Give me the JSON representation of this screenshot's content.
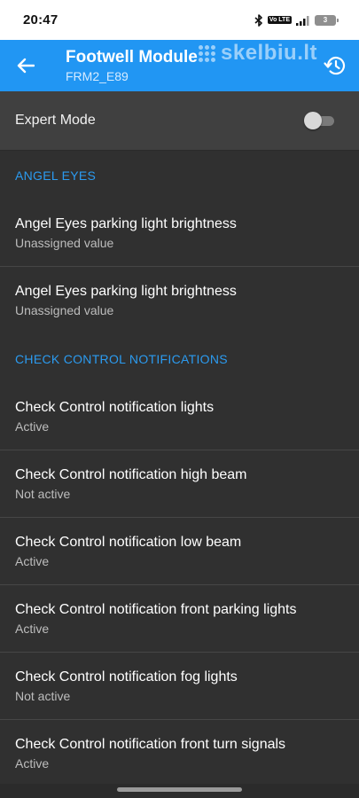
{
  "status_bar": {
    "time": "20:47",
    "volte": "Vo LTE",
    "battery": "3"
  },
  "app_bar": {
    "title": "Footwell Module",
    "subtitle": "FRM2_E89",
    "watermark": "skelbiu.lt"
  },
  "expert_mode": {
    "label": "Expert Mode",
    "enabled": false
  },
  "sections": [
    {
      "header": "ANGEL EYES",
      "items": [
        {
          "title": "Angel Eyes parking light brightness",
          "value": "Unassigned value"
        },
        {
          "title": "Angel Eyes parking light brightness",
          "value": "Unassigned value"
        }
      ]
    },
    {
      "header": "CHECK CONTROL NOTIFICATIONS",
      "items": [
        {
          "title": "Check Control notification lights",
          "value": "Active"
        },
        {
          "title": "Check Control notification high beam",
          "value": "Not active"
        },
        {
          "title": "Check Control notification low beam",
          "value": "Active"
        },
        {
          "title": "Check Control notification front parking lights",
          "value": "Active"
        },
        {
          "title": "Check Control notification fog lights",
          "value": "Not active"
        },
        {
          "title": "Check Control notification front turn signals",
          "value": "Active"
        }
      ]
    }
  ],
  "colors": {
    "app_bar": "#2196f3",
    "accent": "#2b9bf0",
    "background": "#303030"
  },
  "icons": [
    "bluetooth-icon",
    "signal-icon",
    "battery-icon",
    "back-arrow-icon",
    "history-icon"
  ]
}
